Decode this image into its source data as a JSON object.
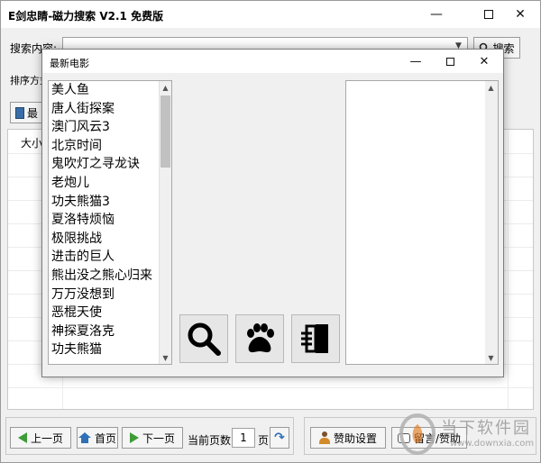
{
  "window": {
    "title": "E剑忠睛-磁力搜索 V2.1 免费版",
    "min_glyph": "—",
    "close_glyph": "✕"
  },
  "search": {
    "label": "搜索内容:",
    "value": "",
    "button_label": "搜索"
  },
  "sort": {
    "label": "排序方式"
  },
  "toolbar": {
    "latest_label": "最"
  },
  "results": {
    "header_label": "大小"
  },
  "pagination": {
    "prev_label": "上一页",
    "home_label": "首页",
    "next_label": "下一页",
    "current_label": "当前页数:",
    "page_value": "1",
    "page_unit": "页"
  },
  "footer": {
    "support_label": "赞助设置",
    "message_label": "留言/赞助"
  },
  "watermark": {
    "title": "当下软件园",
    "url": "www.downxia.com"
  },
  "dialog": {
    "title": "最新电影",
    "min_glyph": "—",
    "close_glyph": "✕",
    "movies": [
      "美人鱼",
      "唐人街探案",
      "澳门风云3",
      "北京时间",
      "鬼吹灯之寻龙诀",
      "老炮儿",
      "功夫熊猫3",
      "夏洛特烦恼",
      "极限挑战",
      "进击的巨人",
      "熊出没之熊心归来",
      "万万没想到",
      "恶棍天使",
      "神探夏洛克",
      "功夫熊猫"
    ],
    "actions": [
      {
        "name": "search",
        "icon": "magnifier-icon"
      },
      {
        "name": "baidu",
        "icon": "paw-icon"
      },
      {
        "name": "exit",
        "icon": "exit-door-icon"
      }
    ]
  },
  "colors": {
    "accent_green": "#3d9c35",
    "accent_blue": "#2f6fb5",
    "window_bg": "#f0f0f0"
  }
}
